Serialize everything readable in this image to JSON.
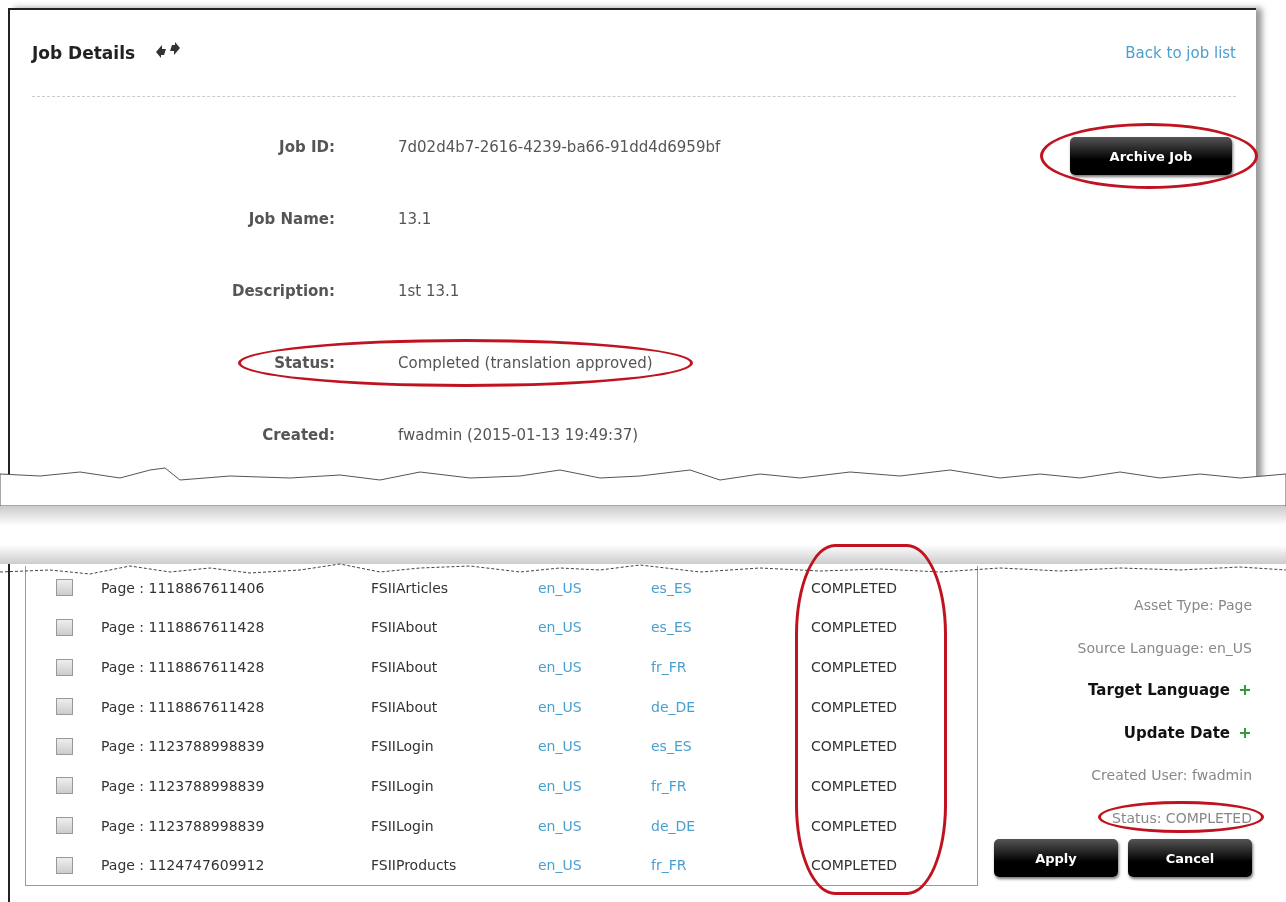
{
  "header": {
    "title": "Job Details",
    "back_link": "Back to job list"
  },
  "details": [
    {
      "label": "Job ID:",
      "value": "7d02d4b7-2616-4239-ba66-91dd4d6959bf",
      "highlighted": false
    },
    {
      "label": "Job Name:",
      "value": "13.1",
      "highlighted": false
    },
    {
      "label": "Description:",
      "value": "1st 13.1",
      "highlighted": false
    },
    {
      "label": "Status:",
      "value": "Completed (translation approved)",
      "highlighted": true
    },
    {
      "label": "Created:",
      "value": "fwadmin (2015-01-13 19:49:37)",
      "highlighted": false
    }
  ],
  "archive_button": {
    "label": "Archive Job",
    "highlighted": true
  },
  "table": {
    "status_highlighted": true,
    "rows": [
      {
        "checked": false,
        "asset": "Page : 1118867611406",
        "name": "FSIIArticles",
        "source": "en_US",
        "target": "es_ES",
        "status": "COMPLETED"
      },
      {
        "checked": false,
        "asset": "Page : 1118867611428",
        "name": "FSIIAbout",
        "source": "en_US",
        "target": "es_ES",
        "status": "COMPLETED"
      },
      {
        "checked": false,
        "asset": "Page : 1118867611428",
        "name": "FSIIAbout",
        "source": "en_US",
        "target": "fr_FR",
        "status": "COMPLETED"
      },
      {
        "checked": false,
        "asset": "Page : 1118867611428",
        "name": "FSIIAbout",
        "source": "en_US",
        "target": "de_DE",
        "status": "COMPLETED"
      },
      {
        "checked": false,
        "asset": "Page : 1123788998839",
        "name": "FSIILogin",
        "source": "en_US",
        "target": "es_ES",
        "status": "COMPLETED"
      },
      {
        "checked": false,
        "asset": "Page : 1123788998839",
        "name": "FSIILogin",
        "source": "en_US",
        "target": "fr_FR",
        "status": "COMPLETED"
      },
      {
        "checked": false,
        "asset": "Page : 1123788998839",
        "name": "FSIILogin",
        "source": "en_US",
        "target": "de_DE",
        "status": "COMPLETED"
      },
      {
        "checked": false,
        "asset": "Page : 1124747609912",
        "name": "FSIIProducts",
        "source": "en_US",
        "target": "fr_FR",
        "status": "COMPLETED"
      }
    ]
  },
  "filters": [
    {
      "kind": "text",
      "label": "Asset Type: Page",
      "highlighted": false
    },
    {
      "kind": "text",
      "label": "Source Language: en_US",
      "highlighted": false
    },
    {
      "kind": "expandable",
      "label": "Target Language",
      "highlighted": false
    },
    {
      "kind": "expandable",
      "label": "Update Date",
      "highlighted": false
    },
    {
      "kind": "text",
      "label": "Created User: fwadmin",
      "highlighted": false
    },
    {
      "kind": "text",
      "label": "Status: COMPLETED",
      "highlighted": true
    }
  ],
  "buttons": [
    "Apply",
    "Cancel"
  ]
}
